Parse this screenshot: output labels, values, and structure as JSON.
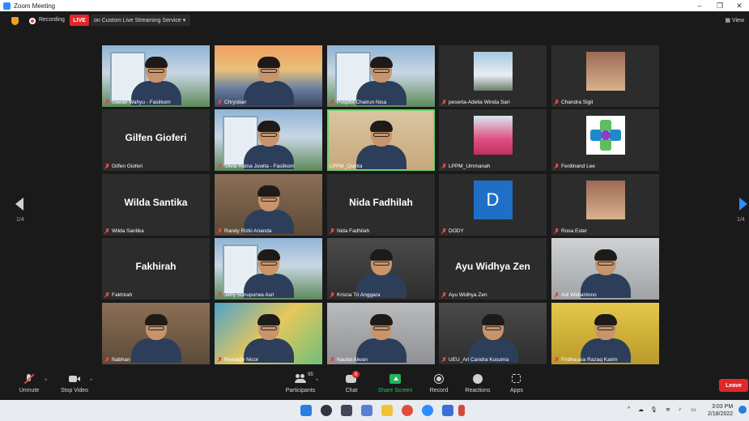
{
  "window": {
    "title": "Zoom Meeting",
    "minimize": "–",
    "maximize": "❐",
    "close": "✕"
  },
  "topbar": {
    "recording_label": "Recording",
    "live_badge": "LIVE",
    "stream_service": "on Custom Live Streaming Service ▾",
    "view_label": "View"
  },
  "navigation": {
    "page_left": "1/4",
    "page_right": "1/4"
  },
  "participants": [
    {
      "name": "Sawali Wahyu - Fasilkom",
      "display": "video",
      "style": "vid-building",
      "muted": true
    },
    {
      "name": "Chrystian",
      "display": "video",
      "style": "vid-sunset",
      "muted": true
    },
    {
      "name": "Puspita Chairun Nisa",
      "display": "video",
      "style": "vid-building",
      "muted": true
    },
    {
      "name": "peserta-Adelia Winda Sari",
      "display": "photo",
      "style": "thumb-photo",
      "muted": true
    },
    {
      "name": "Chandra Sigit",
      "display": "photo",
      "style": "thumb-person",
      "muted": true
    },
    {
      "name": "Gilfen Gioferi",
      "display": "name",
      "big_name": "Gilfen Gioferi",
      "muted": true
    },
    {
      "name": "Silvia Ratna Juwita - Fasilkom",
      "display": "video",
      "style": "vid-building",
      "muted": true
    },
    {
      "name": "LPPM_Quinta",
      "display": "video",
      "style": "vid-warm",
      "muted": false,
      "active": true
    },
    {
      "name": "LPPM_Ummanah",
      "display": "photo",
      "style": "thumb-pink",
      "muted": true
    },
    {
      "name": "Ferdinand Lee",
      "display": "logo",
      "muted": true
    },
    {
      "name": "Wilda Santika",
      "display": "name",
      "big_name": "Wilda Santika",
      "muted": true
    },
    {
      "name": "Randy Rizki Ananda",
      "display": "video",
      "style": "vid-room",
      "muted": true
    },
    {
      "name": "Nida Fadhilah",
      "display": "name",
      "big_name": "Nida Fadhilah",
      "muted": true
    },
    {
      "name": "DODY",
      "display": "initial",
      "initial": "D",
      "muted": true
    },
    {
      "name": "Rosa Ester",
      "display": "photo",
      "style": "thumb-person",
      "muted": true
    },
    {
      "name": "Fakhirah",
      "display": "name",
      "big_name": "Fakhirah",
      "muted": true
    },
    {
      "name": "Jefry Sunupurwa Asri",
      "display": "video",
      "style": "vid-building",
      "muted": true
    },
    {
      "name": "Krisna Tri Anggara",
      "display": "video",
      "style": "vid-dark",
      "muted": true
    },
    {
      "name": "Ayu Widhya Zen",
      "display": "name",
      "big_name": "Ayu Widhya Zen",
      "muted": true
    },
    {
      "name": "Adi Widiantono",
      "display": "video",
      "style": "vid-office",
      "muted": true
    },
    {
      "name": "Nabhan",
      "display": "video",
      "style": "vid-room",
      "muted": true
    },
    {
      "name": "Reinaldy Nicor",
      "display": "video",
      "style": "vid-mural",
      "muted": true
    },
    {
      "name": "Naufal Alwan",
      "display": "video",
      "style": "vid-gray",
      "muted": true
    },
    {
      "name": "UEU_Ari Candra Kusuma",
      "display": "video",
      "style": "vid-dark",
      "muted": true
    },
    {
      "name": "Firdhausia Razaq Karim",
      "display": "video",
      "style": "vid-yellow",
      "muted": true
    }
  ],
  "toolbar": {
    "unmute": "Unmute",
    "stop_video": "Stop Video",
    "participants": "Participants",
    "participants_count": "95",
    "chat": "Chat",
    "chat_badge": "6",
    "share_screen": "Share Screen",
    "record": "Record",
    "reactions": "Reactions",
    "apps": "Apps",
    "leave": "Leave"
  },
  "taskbar": {
    "time": "3:03 PM",
    "date": "2/18/2022"
  },
  "colors": {
    "accent": "#2d8cff",
    "leave": "#e02828",
    "share": "#22b35a",
    "active_border": "#6cd56c"
  }
}
